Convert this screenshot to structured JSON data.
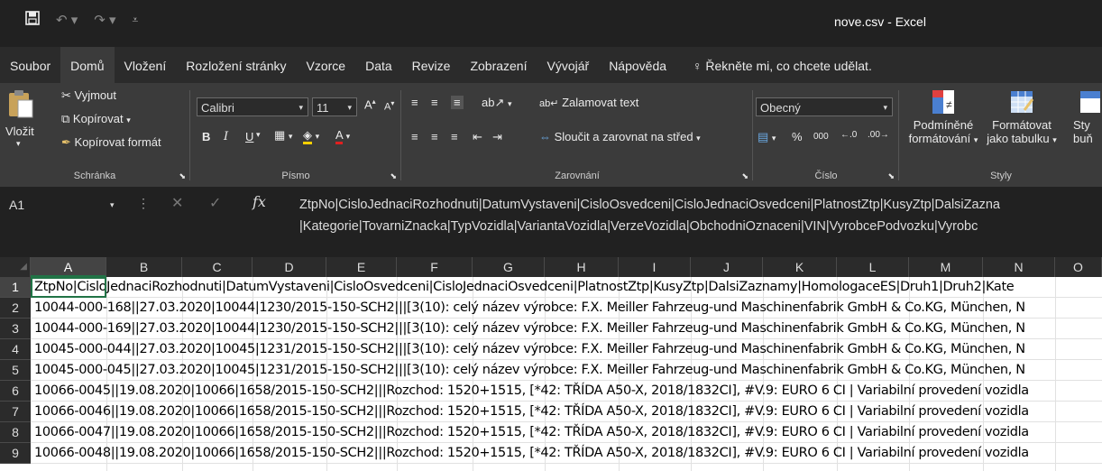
{
  "window": {
    "title": "nove.csv  -  Excel"
  },
  "quick_access": {
    "save_icon": "save-icon",
    "undo_icon": "undo-icon",
    "redo_icon": "redo-icon",
    "customize_icon": "customize-icon"
  },
  "tabs": [
    "Soubor",
    "Domů",
    "Vložení",
    "Rozložení stránky",
    "Vzorce",
    "Data",
    "Revize",
    "Zobrazení",
    "Vývojář",
    "Nápověda"
  ],
  "tell_me": "Řekněte mi, co chcete udělat.",
  "ribbon": {
    "clipboard": {
      "paste": "Vložit",
      "cut": "Vyjmout",
      "copy": "Kopírovat",
      "format_painter": "Kopírovat formát",
      "label": "Schránka"
    },
    "font": {
      "name": "Calibri",
      "size": "11",
      "label": "Písmo",
      "bold": "B",
      "italic": "I",
      "underline": "U"
    },
    "alignment": {
      "wrap": "Zalamovat text",
      "merge": "Sloučit a zarovnat na střed",
      "label": "Zarovnání"
    },
    "number": {
      "format": "Obecný",
      "percent": "%",
      "thousands": "000",
      "label": "Číslo"
    },
    "styles": {
      "conditional_1": "Podmíněné",
      "conditional_2": "formátování",
      "table_1": "Formátovat",
      "table_2": "jako tabulku",
      "cell_1": "Sty",
      "cell_2": "buň",
      "label": "Styly"
    }
  },
  "formula_bar": {
    "name_box": "A1",
    "fx": "fx",
    "line1": "ZtpNo|CisloJednaciRozhodnuti|DatumVystaveni|CisloOsvedceni|CisloJednaciOsvedceni|PlatnostZtp|KusyZtp|DalsiZazna",
    "line2": "|Kategorie|TovarniZnacka|TypVozidla|VariantaVozidla|VerzeVozidla|ObchodniOznaceni|VIN|VyrobcePodvozku|Vyrobc"
  },
  "columns": [
    "A",
    "B",
    "C",
    "D",
    "E",
    "F",
    "G",
    "H",
    "I",
    "J",
    "K",
    "L",
    "M",
    "N",
    "O"
  ],
  "rows": [
    {
      "n": "1",
      "text": "ZtpNo|CisloJednaciRozhodnuti|DatumVystaveni|CisloOsvedceni|CisloJednaciOsvedceni|PlatnostZtp|KusyZtp|DalsiZaznamy|HomologaceES|Druh1|Druh2|Kate"
    },
    {
      "n": "2",
      "text": "10044-000-168||27.03.2020|10044|1230/2015-150-SCH2|||[3(10): celý název výrobce: F.X. Meiller Fahrzeug-und Maschinenfabrik GmbH & Co.KG, München, N"
    },
    {
      "n": "3",
      "text": "10044-000-169||27.03.2020|10044|1230/2015-150-SCH2|||[3(10): celý název výrobce: F.X. Meiller Fahrzeug-und Maschinenfabrik GmbH & Co.KG, München, N"
    },
    {
      "n": "4",
      "text": "10045-000-044||27.03.2020|10045|1231/2015-150-SCH2|||[3(10): celý název výrobce: F.X. Meiller Fahrzeug-und Maschinenfabrik GmbH & Co.KG, München, N"
    },
    {
      "n": "5",
      "text": "10045-000-045||27.03.2020|10045|1231/2015-150-SCH2|||[3(10): celý název výrobce: F.X. Meiller Fahrzeug-und Maschinenfabrik GmbH & Co.KG, München, N"
    },
    {
      "n": "6",
      "text": "10066-0045||19.08.2020|10066|1658/2015-150-SCH2|||Rozchod: 1520+1515, [*42: TŘÍDA A50-X, 2018/1832CI], #V.9: EURO 6 CI | Variabilní provedení vozidla"
    },
    {
      "n": "7",
      "text": "10066-0046||19.08.2020|10066|1658/2015-150-SCH2|||Rozchod: 1520+1515, [*42: TŘÍDA A50-X, 2018/1832CI], #V.9: EURO 6 CI | Variabilní provedení vozidla"
    },
    {
      "n": "8",
      "text": "10066-0047||19.08.2020|10066|1658/2015-150-SCH2|||Rozchod: 1520+1515, [*42: TŘÍDA A50-X, 2018/1832CI], #V.9: EURO 6 CI | Variabilní provedení vozidla"
    },
    {
      "n": "9",
      "text": "10066-0048||19.08.2020|10066|1658/2015-150-SCH2|||Rozchod: 1520+1515, [*42: TŘÍDA A50-X, 2018/1832CI], #V.9: EURO 6 CI | Variabilní provedení vozidla"
    }
  ],
  "colors": {
    "accent": "#217346",
    "titlebar": "#212121",
    "ribbon": "#3b3b3b"
  }
}
